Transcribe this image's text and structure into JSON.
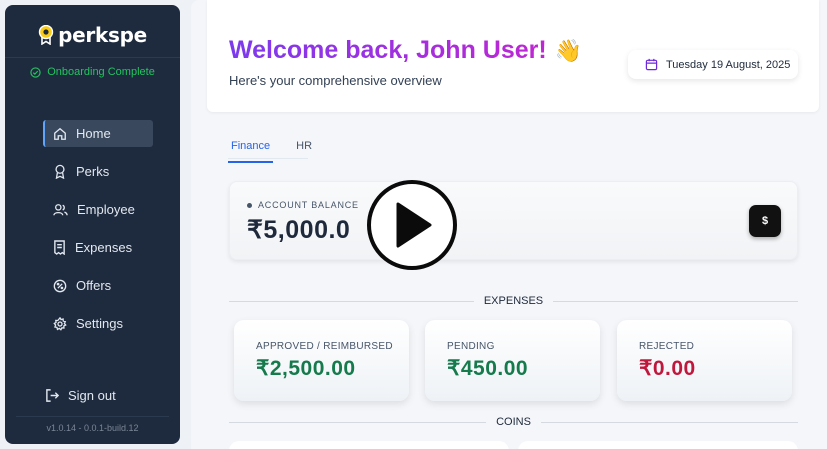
{
  "sidebar": {
    "brand": "perkspe",
    "onboarding_status": "Onboarding Complete",
    "items": [
      {
        "label": "Home",
        "icon": "home-icon",
        "active": true
      },
      {
        "label": "Perks",
        "icon": "award-icon",
        "active": false
      },
      {
        "label": "Employee",
        "icon": "users-icon",
        "active": false
      },
      {
        "label": "Expenses",
        "icon": "receipt-icon",
        "active": false
      },
      {
        "label": "Offers",
        "icon": "percent-badge-icon",
        "active": false
      },
      {
        "label": "Settings",
        "icon": "gear-icon",
        "active": false
      }
    ],
    "signout_label": "Sign out",
    "version": "v1.0.14 - 0.0.1-build.12"
  },
  "header": {
    "welcome": "Welcome back, John User!",
    "wave_emoji": "👋",
    "subtitle": "Here's your comprehensive overview",
    "date": "Tuesday 19 August, 2025"
  },
  "tabs": [
    {
      "label": "Finance",
      "active": true
    },
    {
      "label": "HR",
      "active": false
    }
  ],
  "balance": {
    "label": "ACCOUNT BALANCE",
    "value": "₹5,000.0",
    "button_label": "$"
  },
  "expenses": {
    "section_title": "EXPENSES",
    "cards": [
      {
        "label": "APPROVED / REIMBURSED",
        "value": "₹2,500.00",
        "color": "#157a4c"
      },
      {
        "label": "PENDING",
        "value": "₹450.00",
        "color": "#157a4c"
      },
      {
        "label": "REJECTED",
        "value": "₹0.00",
        "color": "#c0183c"
      }
    ]
  },
  "coins": {
    "section_title": "COINS"
  },
  "colors": {
    "sidebar_bg": "#1e2a3d",
    "accent": "#2563eb",
    "success": "#22c55e",
    "brand_gradient_start": "#7c3aed",
    "brand_gradient_end": "#c026d3"
  }
}
